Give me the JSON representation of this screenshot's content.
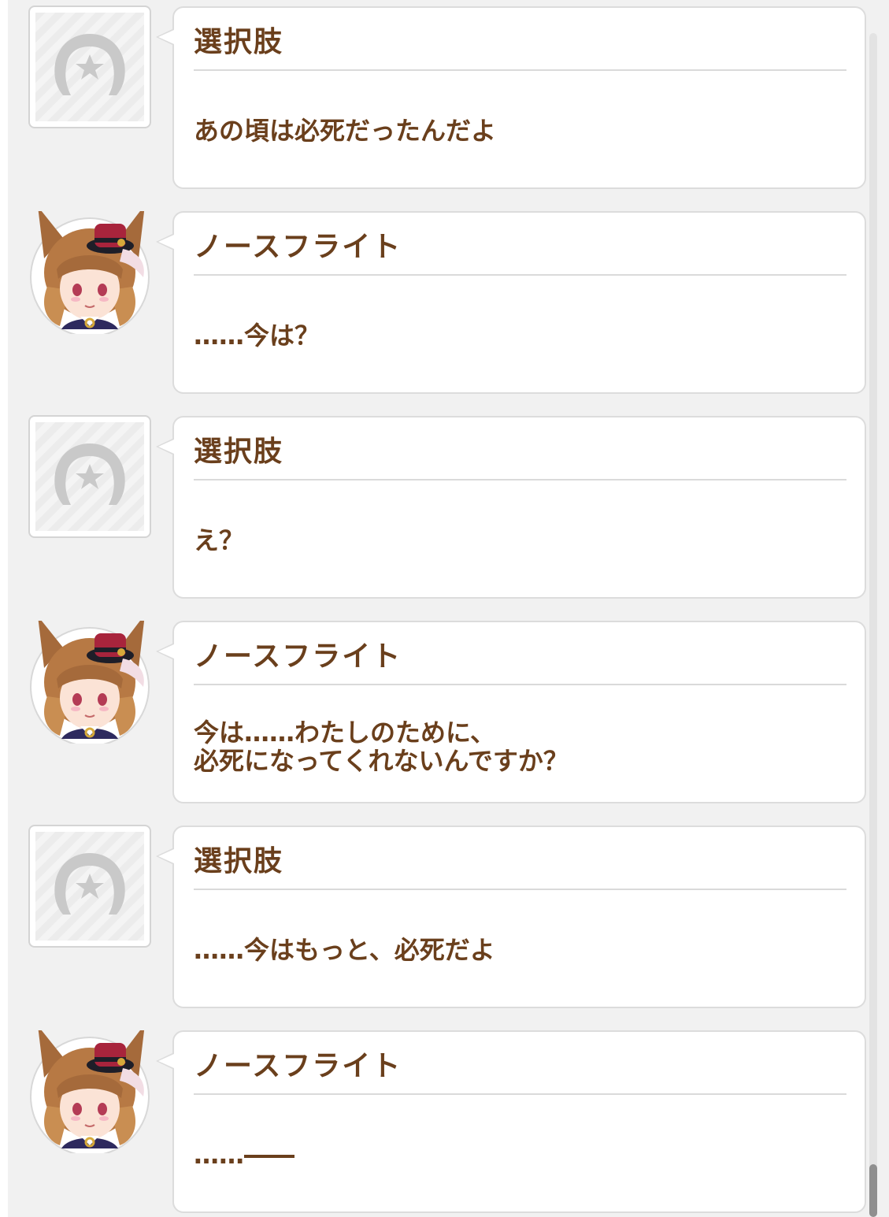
{
  "dialogue": [
    {
      "speaker": "選択肢",
      "avatar": "choice-horseshoe-icon",
      "text": "あの頃は必死だったんだよ"
    },
    {
      "speaker": "ノースフライト",
      "avatar": "north-flight-portrait",
      "text": "……今は？"
    },
    {
      "speaker": "選択肢",
      "avatar": "choice-horseshoe-icon",
      "text": "え？"
    },
    {
      "speaker": "ノースフライト",
      "avatar": "north-flight-portrait",
      "text": "今は……わたしのために、\n必死になってくれないんですか？"
    },
    {
      "speaker": "選択肢",
      "avatar": "choice-horseshoe-icon",
      "text": "……今はもっと、必死だよ"
    },
    {
      "speaker": "ノースフライト",
      "avatar": "north-flight-portrait",
      "text": "……――"
    }
  ],
  "colors": {
    "text_brown": "#6a3f1c",
    "panel_bg": "#f1f1f1",
    "bubble_border": "#dcdcdc",
    "scroll_thumb": "#8f8f8f"
  }
}
